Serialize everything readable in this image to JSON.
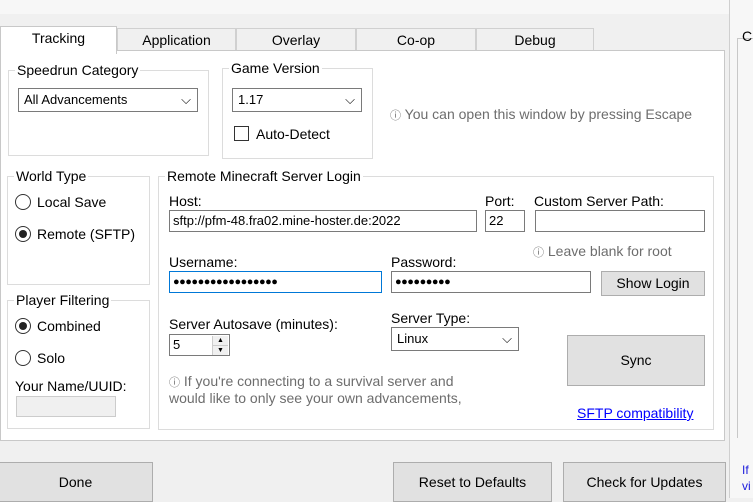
{
  "window": {
    "title_fragment": "…",
    "right_edge_letter": "C",
    "right_edge_text": "If\nvi"
  },
  "tabs": [
    {
      "label": "Tracking"
    },
    {
      "label": "Application"
    },
    {
      "label": "Overlay"
    },
    {
      "label": "Co-op"
    },
    {
      "label": "Debug"
    }
  ],
  "speedrun_category": {
    "title": "Speedrun Category",
    "value": "All Advancements"
  },
  "game_version": {
    "title": "Game Version",
    "value": "1.17",
    "auto_detect_label": "Auto-Detect",
    "auto_detect_checked": false
  },
  "escape_hint": "You can open this window by pressing Escape",
  "world_type": {
    "title": "World Type",
    "options": [
      {
        "label": "Local Save",
        "checked": false
      },
      {
        "label": "Remote (SFTP)",
        "checked": true
      }
    ]
  },
  "server_login": {
    "title": "Remote Minecraft Server Login",
    "host_label": "Host:",
    "host_value": "sftp://pfm-48.fra02.mine-hoster.de:2022",
    "port_label": "Port:",
    "port_value": "22",
    "custom_path_label": "Custom Server Path:",
    "custom_path_value": "",
    "leave_blank_hint": "Leave blank for root",
    "username_label": "Username:",
    "username_value": "●●●●●●●●●●●●●●●●●",
    "password_label": "Password:",
    "password_value": "●●●●●●●●●",
    "show_login_label": "Show Login",
    "autosave_label": "Server Autosave (minutes):",
    "autosave_value": "5",
    "server_type_label": "Server Type:",
    "server_type_value": "Linux",
    "sync_label": "Sync",
    "survival_hint_line1": "If you're connecting to a survival server and",
    "survival_hint_line2": "would like to only see your own advancements,",
    "sftp_link": "SFTP compatibility"
  },
  "player_filtering": {
    "title": "Player Filtering",
    "options": [
      {
        "label": "Combined",
        "checked": true
      },
      {
        "label": "Solo",
        "checked": false
      }
    ],
    "name_label": "Your Name/UUID:",
    "name_value": ""
  },
  "footer": {
    "done_label": "Done",
    "reset_label": "Reset to Defaults",
    "updates_label": "Check for Updates"
  },
  "icons": {
    "info": "ⓘ",
    "chevron": "⌵",
    "spin_up": "▲",
    "spin_down": "▼"
  }
}
